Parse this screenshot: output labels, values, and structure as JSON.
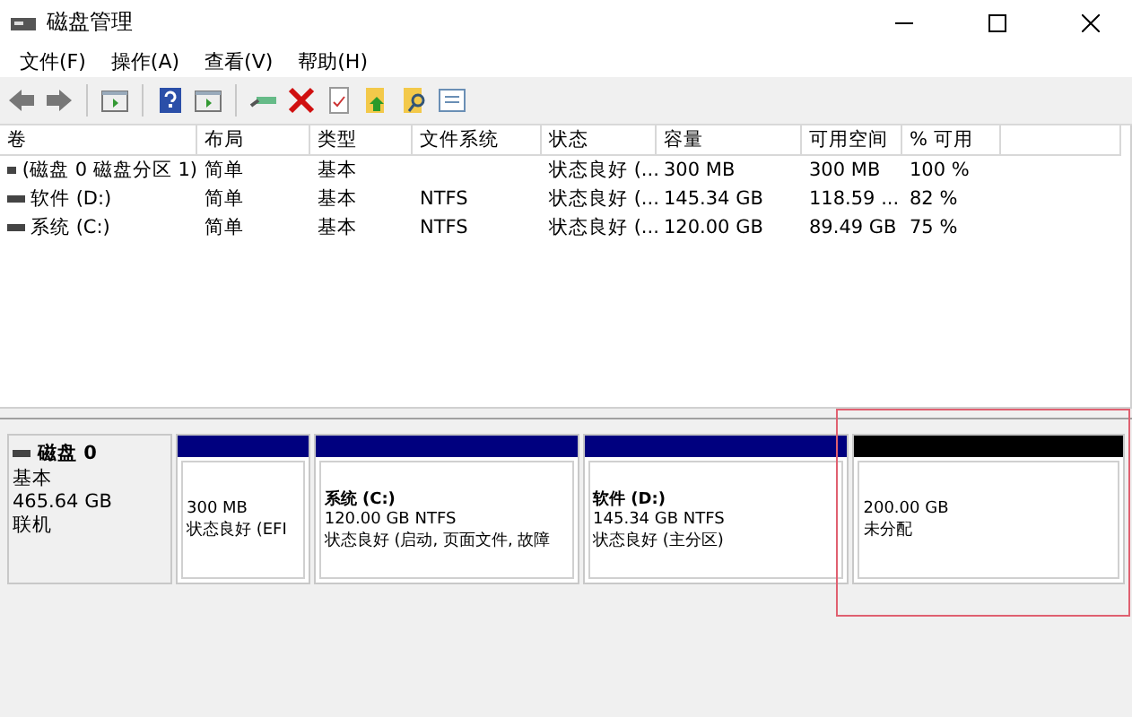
{
  "window": {
    "title": "磁盘管理"
  },
  "menu": [
    "文件(F)",
    "操作(A)",
    "查看(V)",
    "帮助(H)"
  ],
  "table": {
    "columns": [
      "卷",
      "布局",
      "类型",
      "文件系统",
      "状态",
      "容量",
      "可用空间",
      "% 可用"
    ],
    "rows": [
      {
        "cells": [
          "(磁盘 0 磁盘分区 1)",
          "简单",
          "基本",
          "",
          "状态良好 (...",
          "300 MB",
          "300 MB",
          "100 %"
        ]
      },
      {
        "cells": [
          "软件 (D:)",
          "简单",
          "基本",
          "NTFS",
          "状态良好 (...",
          "145.34 GB",
          "118.59 ...",
          "82 %"
        ]
      },
      {
        "cells": [
          "系统 (C:)",
          "简单",
          "基本",
          "NTFS",
          "状态良好 (...",
          "120.00 GB",
          "89.49 GB",
          "75 %"
        ]
      }
    ]
  },
  "disk": {
    "name": "磁盘 0",
    "type": "基本",
    "size": "465.64 GB",
    "status": "联机",
    "partitions": [
      {
        "kind": "primary",
        "size": "300 MB",
        "status": "状态良好 (EFI",
        "highlighted": false
      },
      {
        "kind": "primary",
        "title": "系统  (C:)",
        "size": "120.00 GB NTFS",
        "status": "状态良好 (启动, 页面文件, 故障",
        "highlighted": false
      },
      {
        "kind": "primary",
        "title": "软件  (D:)",
        "size": "145.34 GB NTFS",
        "status": "状态良好 (主分区)",
        "highlighted": false
      },
      {
        "kind": "unallocated",
        "size": "200.00 GB",
        "status": "未分配",
        "highlighted": true
      }
    ]
  }
}
